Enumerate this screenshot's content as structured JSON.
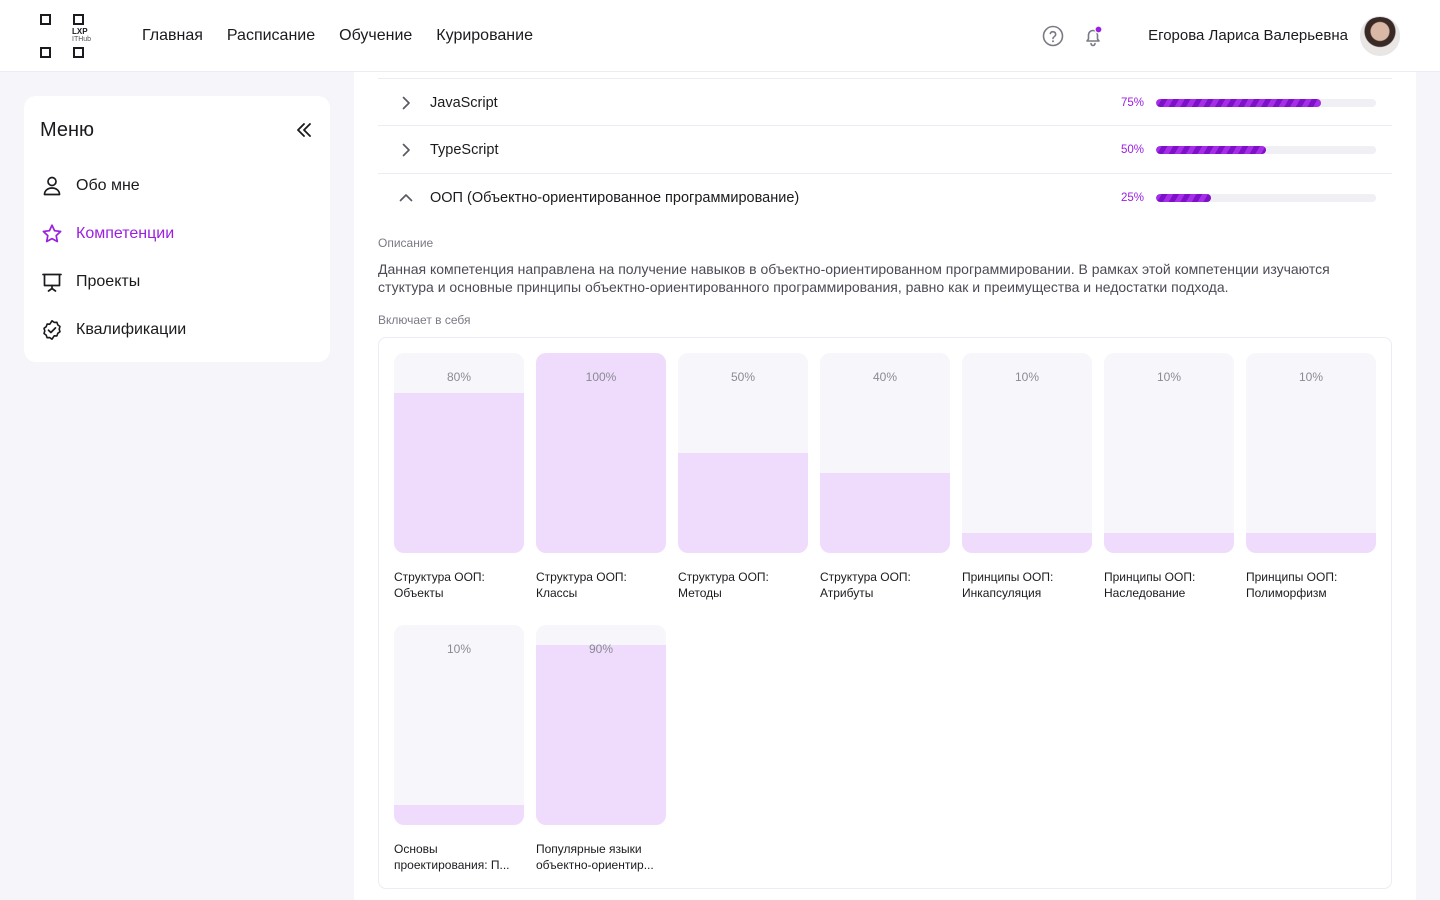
{
  "header": {
    "logo": {
      "line1": "LXP",
      "line2": "ITHub"
    },
    "nav": [
      "Главная",
      "Расписание",
      "Обучение",
      "Курирование"
    ],
    "user_name": "Егорова Лариса Валерьевна"
  },
  "sidebar": {
    "title": "Меню",
    "items": [
      {
        "label": "Обо мне",
        "icon": "user-icon"
      },
      {
        "label": "Компетенции",
        "icon": "star-icon",
        "active": true
      },
      {
        "label": "Проекты",
        "icon": "presentation-icon"
      },
      {
        "label": "Квалификации",
        "icon": "badge-check-icon"
      }
    ]
  },
  "competencies": [
    {
      "name": "JavaScript",
      "percent_label": "75%",
      "progress": 0.75,
      "expanded": false
    },
    {
      "name": "TypeScript",
      "percent_label": "50%",
      "progress": 0.5,
      "expanded": false
    },
    {
      "name": "ООП (Объектно-ориентированное программирование)",
      "percent_label": "25%",
      "progress": 0.25,
      "expanded": true
    }
  ],
  "details": {
    "description_label": "Описание",
    "description": "Данная компетенция направлена на получение навыков в объектно-ориентированном программировании. В рамках этой компетенции изучаются стуктура и основные принципы объектно-ориентированного программирования, равно как и преимущества и недостатки подхода.",
    "includes_label": "Включает в себя",
    "subskills": [
      {
        "percent_label": "80%",
        "level": 0.8,
        "line1": "Структура ООП:",
        "line2": "Объекты"
      },
      {
        "percent_label": "100%",
        "level": 1.0,
        "line1": "Структура ООП:",
        "line2": "Классы"
      },
      {
        "percent_label": "50%",
        "level": 0.5,
        "line1": "Структура ООП:",
        "line2": "Методы"
      },
      {
        "percent_label": "40%",
        "level": 0.4,
        "line1": "Структура ООП:",
        "line2": "Атрибуты"
      },
      {
        "percent_label": "10%",
        "level": 0.1,
        "line1": "Принципы ООП:",
        "line2": "Инкапсуляция"
      },
      {
        "percent_label": "10%",
        "level": 0.1,
        "line1": "Принципы ООП:",
        "line2": "Наследование"
      },
      {
        "percent_label": "10%",
        "level": 0.1,
        "line1": "Принципы ООП:",
        "line2": "Полиморфизм"
      },
      {
        "percent_label": "10%",
        "level": 0.1,
        "line1": "Основы",
        "line2": "проектирования: П..."
      },
      {
        "percent_label": "90%",
        "level": 0.9,
        "line1": "Популярные языки",
        "line2": "объектно-ориентир..."
      }
    ]
  },
  "colors": {
    "accent": "#9b1fe0",
    "bar_fill": "#efdcfc",
    "bar_bg": "#f7f7fb"
  }
}
